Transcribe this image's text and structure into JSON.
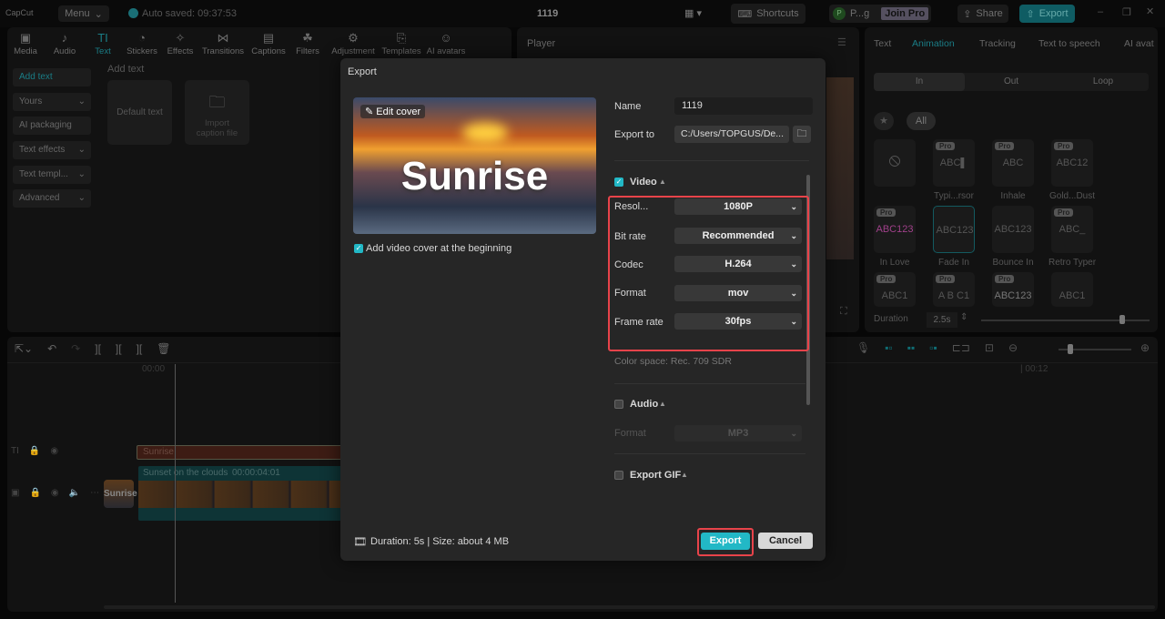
{
  "app": {
    "logo": "CapCut",
    "menu": "Menu",
    "autosave": "Auto saved: 09:37:53",
    "project_title": "1119",
    "shortcuts": "Shortcuts",
    "user": "P...g",
    "join_pro": "Join Pro",
    "share": "Share",
    "export": "Export"
  },
  "toolbar": [
    {
      "label": "Media",
      "icon": "▣"
    },
    {
      "label": "Audio",
      "icon": "♪"
    },
    {
      "label": "Text",
      "icon": "TI"
    },
    {
      "label": "Stickers",
      "icon": "◔"
    },
    {
      "label": "Effects",
      "icon": "✧"
    },
    {
      "label": "Transitions",
      "icon": "⋈"
    },
    {
      "label": "Captions",
      "icon": "▤"
    },
    {
      "label": "Filters",
      "icon": "☘"
    },
    {
      "label": "Adjustment",
      "icon": "⚙"
    },
    {
      "label": "Templates",
      "icon": "⎘"
    },
    {
      "label": "AI avatars",
      "icon": "☺"
    }
  ],
  "sidebar": [
    "Add text",
    "Yours",
    "AI packaging",
    "Text effects",
    "Text templ...",
    "Advanced"
  ],
  "text_panel": {
    "heading": "Add text",
    "default_text": "Default text",
    "import_caption": "Import caption file"
  },
  "player": {
    "title": "Player"
  },
  "right_panel": {
    "tabs": [
      "Text",
      "Animation",
      "Tracking",
      "Text to speech",
      "AI avat"
    ],
    "sub_tabs": [
      "In",
      "Out",
      "Loop"
    ],
    "filter_all": "All",
    "pro_badge": "Pro",
    "items": [
      {
        "name": "",
        "preview": "⦸"
      },
      {
        "name": "Typi...rsor",
        "preview": "ABC▌"
      },
      {
        "name": "Inhale",
        "preview": "ABC"
      },
      {
        "name": "Gold...Dust",
        "preview": "ABC12"
      },
      {
        "name": "In Love",
        "preview": "ABC123"
      },
      {
        "name": "Fade In",
        "preview": "ABC123"
      },
      {
        "name": "Bounce In",
        "preview": "ABC123"
      },
      {
        "name": "Retro Typer",
        "preview": "ABC_"
      },
      {
        "name": "",
        "preview": "ABC1"
      },
      {
        "name": "",
        "preview": "A B C1"
      },
      {
        "name": "",
        "preview": "ABC123"
      },
      {
        "name": "",
        "preview": "ABC1"
      }
    ],
    "duration_label": "Duration",
    "duration_value": "2.5s"
  },
  "timeline": {
    "time_start": "00:00",
    "time_mark": "| 00:12",
    "text_clip": "Sunrise",
    "video_clip": "Sunset on the clouds",
    "video_duration": "00:00:04:01",
    "cover_label": "Sunrise"
  },
  "dialog": {
    "title": "Export",
    "edit_cover": "Edit cover",
    "cover_text": "Sunrise",
    "add_cover": "Add video cover at the beginning",
    "name_label": "Name",
    "name_value": "1119",
    "export_to_label": "Export to",
    "export_to_value": "C:/Users/TOPGUS/De...",
    "video_label": "Video",
    "resolution_label": "Resol...",
    "resolution": "1080P",
    "bitrate_label": "Bit rate",
    "bitrate": "Recommended",
    "codec_label": "Codec",
    "codec": "H.264",
    "format_label": "Format",
    "format": "mov",
    "framerate_label": "Frame rate",
    "framerate": "30fps",
    "color_space": "Color space: Rec. 709 SDR",
    "audio_label": "Audio",
    "audio_format_label": "Format",
    "audio_format": "MP3",
    "gif_label": "Export GIF",
    "footer_info": "Duration: 5s | Size: about 4 MB",
    "export_button": "Export",
    "cancel_button": "Cancel"
  },
  "colors": {
    "accent": "#22b8c6",
    "highlight": "#e8434a"
  }
}
